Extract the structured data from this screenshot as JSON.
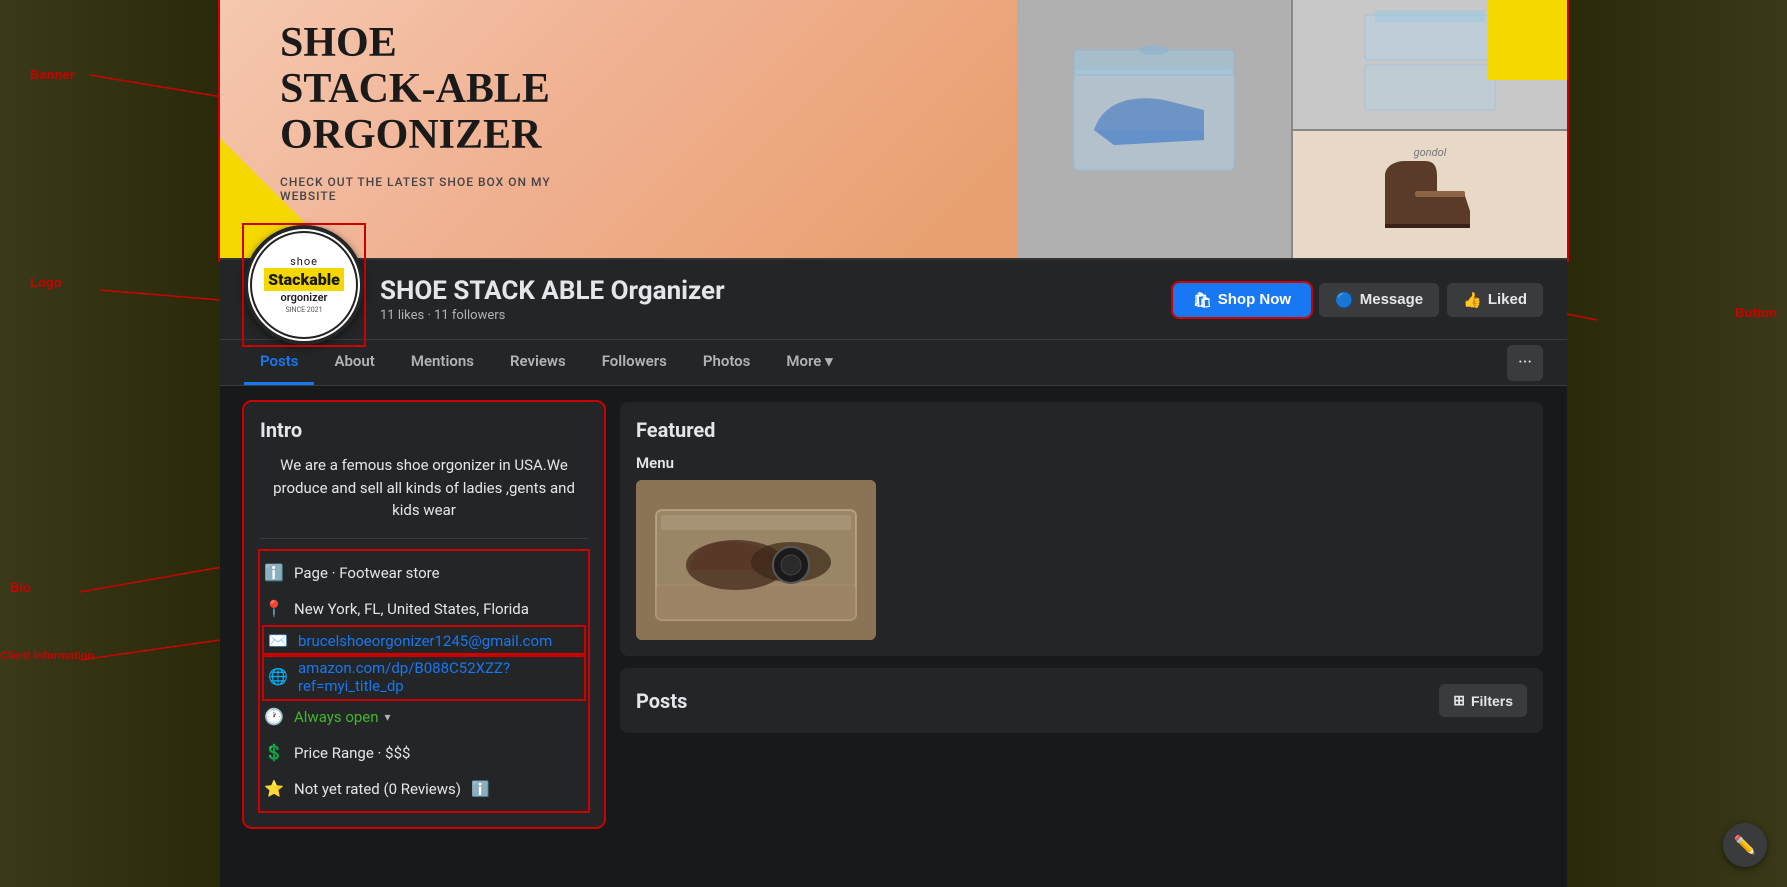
{
  "page": {
    "title": "SHOE STACK ABLE Organizer",
    "stats": "11 likes · 11 followers",
    "cover_title_line1": "SHOE",
    "cover_title_line2": "STACK-ABLE",
    "cover_title_line3": "ORGONIZER",
    "cover_subtitle": "CHECK OUT THE LATEST SHOE BOX ON MY WEBSITE"
  },
  "logo": {
    "line1": "shoe",
    "line2": "Stackable",
    "line3": "orgonizer",
    "line4": "SINCE 2021"
  },
  "actions": {
    "shop_now": "Shop Now",
    "message": "Message",
    "liked": "Liked"
  },
  "nav": {
    "tabs": [
      {
        "label": "Posts",
        "active": true
      },
      {
        "label": "About"
      },
      {
        "label": "Mentions"
      },
      {
        "label": "Reviews"
      },
      {
        "label": "Followers"
      },
      {
        "label": "Photos"
      },
      {
        "label": "More"
      }
    ]
  },
  "intro": {
    "title": "Intro",
    "bio": "We are a femous shoe orgonizer in USA.We produce and sell all kinds of ladies ,gents and kids wear",
    "info": [
      {
        "icon": "ℹ",
        "text": "Page · Footwear store"
      },
      {
        "icon": "📍",
        "text": "New York, FL, United States, Florida"
      },
      {
        "icon": "✉",
        "text": "brucelshoeorgonizer1245@gmail.com",
        "type": "email"
      },
      {
        "icon": "🌐",
        "text": "amazon.com/dp/B088C52XZZ?ref=myi_title_dp",
        "type": "link"
      },
      {
        "icon": "🕐",
        "text": "Always open",
        "type": "hours"
      },
      {
        "icon": "$",
        "text": "Price Range · $$$"
      },
      {
        "icon": "★",
        "text": "Not yet rated (0 Reviews)"
      }
    ]
  },
  "featured": {
    "title": "Featured",
    "menu_label": "Menu"
  },
  "posts": {
    "title": "Posts",
    "filters_label": "Filters"
  },
  "annotations": {
    "banner": "Banner",
    "logo": "Logo",
    "button": "Button",
    "bio": "Bio",
    "client_info": "Client Information"
  }
}
